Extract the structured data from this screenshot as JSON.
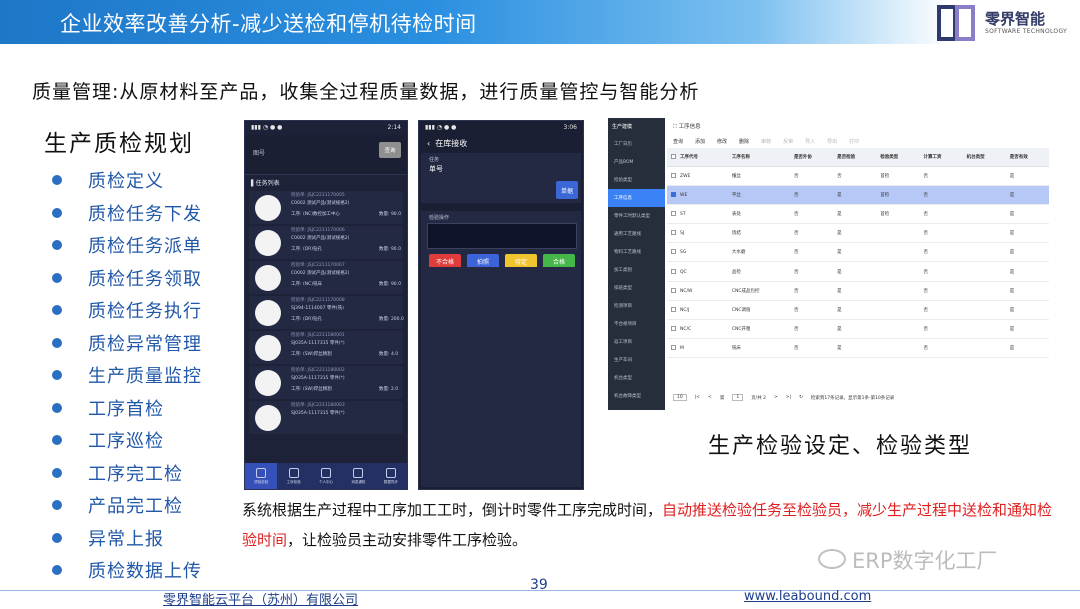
{
  "header": {
    "title": "企业效率改善分析-减少送检和停机待检时间",
    "logo_name": "零界智能",
    "logo_sub": "SOFTWARE TECHNOLOGY"
  },
  "headline": "质量管理:从原材料至产品，收集全过程质量数据，进行质量管控与智能分析",
  "left": {
    "title": "生产质检规划",
    "items": [
      "质检定义",
      "质检任务下发",
      "质检任务派单",
      "质检任务领取",
      "质检任务执行",
      "质检异常管理",
      "生产质量监控",
      "工序首检",
      "工序巡检",
      "工序完工检",
      "产品完工检",
      "异常上报",
      "质检数据上传"
    ]
  },
  "phone1": {
    "time": "2:14",
    "header_label": "图号",
    "query_label": "查询",
    "list_title": "任务列表",
    "tasks": [
      {
        "no": "检验单: JSJC2211170005",
        "name": "C0002 测试产品(测试规格2)",
        "proc": "工序: (NC)数控加工中心",
        "qty": "数量: 90.0"
      },
      {
        "no": "检验单: JSJC2211170006",
        "name": "C0002 测试产品(测试规格2)",
        "proc": "工序: (DR)钻孔",
        "qty": "数量: 90.0"
      },
      {
        "no": "检验单: JSJC2211170007",
        "name": "C0002 测试产品(测试规格2)",
        "proc": "工序: (NC)铣床",
        "qty": "数量: 90.0"
      },
      {
        "no": "检验单: JSJC2211170008",
        "name": "SJ394-1114007 零件(铣)",
        "proc": "工序: (DR)钻孔",
        "qty": "数量: 200.0"
      },
      {
        "no": "检验单: JSJC2211180001",
        "name": "SJ035A-1117315 零件(*)",
        "proc": "工序: (SW)焊丝精割",
        "qty": "数量: 4.0"
      },
      {
        "no": "检验单: JSJC2211180002",
        "name": "SJ035A-1117315 零件(*)",
        "proc": "工序: (SW)焊丝精割",
        "qty": "数量: 2.0"
      },
      {
        "no": "检验单: JSJC2211180003",
        "name": "SJ035A-1117315 零件(*)",
        "proc": "",
        "qty": ""
      }
    ],
    "tabs": [
      "质检检验",
      "工序检验",
      "个人中心",
      "消息通知",
      "数据同步"
    ]
  },
  "phone2": {
    "time": "3:06",
    "nav_title": "在库接收",
    "form_label": "任务",
    "form_value": "单号",
    "scan_label": "单据",
    "result_label": "检验操作",
    "buttons": [
      "不合格",
      "拍照",
      "待定",
      "合格"
    ]
  },
  "webapp": {
    "sidebar_title": "生产建模",
    "sidebar_items": [
      "工厂日历",
      "产品BOM",
      "检验类型",
      "工序信息",
      "零件工时默认类型",
      "通用工艺路线",
      "物料工艺路线",
      "加工类别",
      "排班类型",
      "检测项目",
      "不合格项目",
      "返工项目",
      "生产车间",
      "机台类型",
      "机台故障类型"
    ],
    "active_item": "工序信息",
    "page_title": "工序信息",
    "toolbar": [
      "查询",
      "添加",
      "修改",
      "删除",
      "审核",
      "反审",
      "导入",
      "导出",
      "打印"
    ],
    "columns": [
      "工序代号",
      "工序名称",
      "是否外协",
      "是否检验",
      "检验类型",
      "计算工资",
      "机台类型",
      "是否有效"
    ],
    "rows": [
      [
        "ZWE",
        "懂丝",
        "否",
        "否",
        "首检",
        "否",
        "",
        "是"
      ],
      [
        "WE",
        "平丝",
        "否",
        "是",
        "首检",
        "否",
        "",
        "是"
      ],
      [
        "ST",
        "表处",
        "否",
        "是",
        "首检",
        "否",
        "",
        "是"
      ],
      [
        "SJ",
        "烧结",
        "否",
        "是",
        "",
        "否",
        "",
        "是"
      ],
      [
        "SG",
        "大水磨",
        "否",
        "是",
        "",
        "否",
        "",
        "是"
      ],
      [
        "QC",
        "品检",
        "否",
        "是",
        "",
        "否",
        "",
        "是"
      ],
      [
        "NC/W",
        "CNC成品包控",
        "否",
        "是",
        "",
        "否",
        "",
        "是"
      ],
      [
        "NC/J",
        "CNC调值",
        "否",
        "是",
        "",
        "否",
        "",
        "是"
      ],
      [
        "NC/C",
        "CNC开粗",
        "否",
        "是",
        "",
        "否",
        "",
        "是"
      ],
      [
        "M",
        "铣床",
        "否",
        "是",
        "",
        "否",
        "",
        "是"
      ]
    ],
    "selected_row": 1,
    "pager": {
      "page_size": "10",
      "page_prefix": "第",
      "page": "1",
      "page_suffix": "页/共 2",
      "summary": "检索到17条记录，显示第1条-第10条记录"
    }
  },
  "caption": "生产检验设定、检验类型",
  "description": {
    "part1": "系统根据生产过程中工序加工工时，倒计时零件工序完成时间，",
    "part2_red": "自动推送检验任务至检验员，减少生产过程中送检和通知检验时间",
    "part3": "，让检验员主动安排零件工序检验。"
  },
  "watermark": "ERP数字化工厂",
  "footer": {
    "page": "39",
    "company": "零界智能云平台（苏州）有限公司",
    "url": "www.leabound.com"
  },
  "colors": {
    "header_blue": "#1f77c8",
    "list_blue": "#2258a8",
    "highlight_red": "#e02020"
  }
}
